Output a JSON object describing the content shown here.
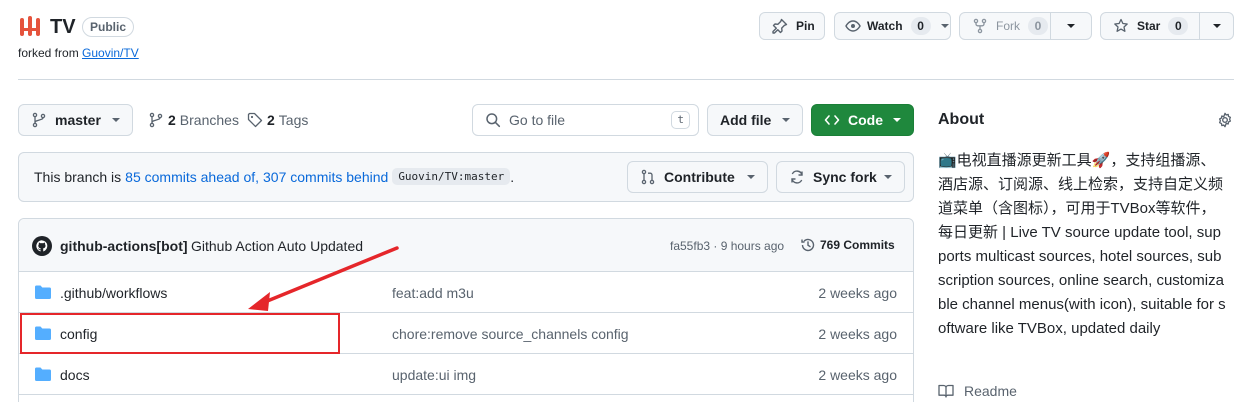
{
  "repo": {
    "name": "TV",
    "visibility": "Public",
    "forked_prefix": "forked from",
    "forked_from": "Guovin/TV"
  },
  "actions": {
    "pin": "Pin",
    "watch": "Watch",
    "watch_count": "0",
    "fork": "Fork",
    "fork_count": "0",
    "star": "Star",
    "star_count": "0"
  },
  "toolbar": {
    "branch": "master",
    "branches_count": "2",
    "branches_label": "Branches",
    "tags_count": "2",
    "tags_label": "Tags",
    "goto_placeholder": "Go to file",
    "goto_shortcut": "t",
    "add_file": "Add file",
    "code": "Code"
  },
  "branch_status": {
    "prefix": "This branch is",
    "ahead": "85 commits ahead of,",
    "behind": "307 commits behind",
    "ref": "Guovin/TV:master",
    "suffix": ".",
    "contribute": "Contribute",
    "sync": "Sync fork"
  },
  "latest_commit": {
    "author": "github-actions[bot]",
    "message": "Github Action Auto Updated",
    "hash_time": "fa55fb3 · 9 hours ago",
    "commits_count": "769 Commits"
  },
  "files": [
    {
      "name": ".github/workflows",
      "message": "feat:add m3u",
      "time": "2 weeks ago"
    },
    {
      "name": "config",
      "message": "chore:remove source_channels config",
      "time": "2 weeks ago"
    },
    {
      "name": "docs",
      "message": "update:ui img",
      "time": "2 weeks ago"
    }
  ],
  "about": {
    "title": "About",
    "description": "📺电视直播源更新工具🚀，支持组播源、酒店源、订阅源、线上检索，支持自定义频道菜单（含图标），可用于TVBox等软件，每日更新 | Live TV source update tool, supports multicast sources, hotel sources, subscription sources, online search, customizable channel menus(with icon), suitable for software like TVBox, updated daily",
    "readme": "Readme"
  },
  "colors": {
    "accent": "#0969da",
    "code_button": "#1f883d",
    "folder": "#54aeff",
    "annotation": "#e5262a"
  }
}
